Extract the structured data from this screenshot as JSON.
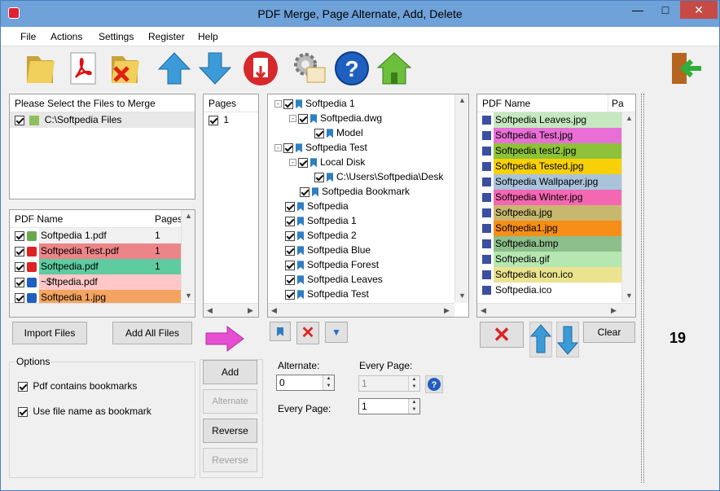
{
  "window": {
    "title": "PDF Merge, Page Alternate, Add, Delete",
    "minimize": "—",
    "maximize": "□",
    "close": "✕"
  },
  "menu": [
    "File",
    "Actions",
    "Settings",
    "Register",
    "Help"
  ],
  "files_panel": {
    "header": "Please Select the Files to Merge",
    "items": [
      {
        "label": "C:\\Softpedia Files"
      }
    ]
  },
  "pdf_list": {
    "col_name": "PDF Name",
    "col_pages": "Pages",
    "rows": [
      {
        "name": "Softpedia 1.pdf",
        "pages": "1",
        "color": "#f0f0f0"
      },
      {
        "name": "Softpedia Test.pdf",
        "pages": "1",
        "color": "#ec8587"
      },
      {
        "name": "Softpedia.pdf",
        "pages": "1",
        "color": "#5ecba1"
      },
      {
        "name": "~$ftpedia.pdf",
        "pages": "",
        "color": "#ffc7c7"
      },
      {
        "name": "Softpedia 1.jpg",
        "pages": "",
        "color": "#f4a460"
      }
    ]
  },
  "pages_panel": {
    "header": "Pages",
    "items": [
      "1"
    ]
  },
  "tree": {
    "rows": [
      {
        "label": "Softpedia 1",
        "indent": 0,
        "exp": "-"
      },
      {
        "label": "Softpedia.dwg",
        "indent": 1,
        "exp": "-"
      },
      {
        "label": "Model",
        "indent": 2,
        "exp": ""
      },
      {
        "label": "Softpedia Test",
        "indent": 0,
        "exp": "-"
      },
      {
        "label": "Local Disk",
        "indent": 1,
        "exp": "-"
      },
      {
        "label": "C:\\Users\\Softpedia\\Desk",
        "indent": 2,
        "exp": ""
      },
      {
        "label": "Softpedia Bookmark",
        "indent": 1,
        "exp": ""
      },
      {
        "label": "Softpedia",
        "indent": 0,
        "exp": ""
      },
      {
        "label": "Softpedia 1",
        "indent": 0,
        "exp": ""
      },
      {
        "label": "Softpedia 2",
        "indent": 0,
        "exp": ""
      },
      {
        "label": "Softpedia Blue",
        "indent": 0,
        "exp": ""
      },
      {
        "label": "Softpedia Forest",
        "indent": 0,
        "exp": ""
      },
      {
        "label": "Softpedia Leaves",
        "indent": 0,
        "exp": ""
      },
      {
        "label": "Softpedia Test",
        "indent": 0,
        "exp": ""
      }
    ]
  },
  "right_list": {
    "col_name": "PDF Name",
    "col_pages": "Pa",
    "rows": [
      {
        "name": "Softpedia Leaves.jpg",
        "color": "#c5e8c0"
      },
      {
        "name": "Softpedia Test.jpg",
        "color": "#e86fd6"
      },
      {
        "name": "Softpedia test2.jpg",
        "color": "#8ec23a"
      },
      {
        "name": "Softpedia Tested.jpg",
        "color": "#f8d008"
      },
      {
        "name": "Softpedia Wallpaper.jpg",
        "color": "#a9c3db"
      },
      {
        "name": "Softpedia Winter.jpg",
        "color": "#f467b3"
      },
      {
        "name": "Softpedia.jpg",
        "color": "#c8b86f"
      },
      {
        "name": "Softpedia1.jpg",
        "color": "#f68e17"
      },
      {
        "name": "Softpedia.bmp",
        "color": "#8dbf8a"
      },
      {
        "name": "Softpedia.gif",
        "color": "#b6e7b1"
      },
      {
        "name": "Softpedia Icon.ico",
        "color": "#ebe38e"
      },
      {
        "name": "Softpedia.ico",
        "color": "#ffffff"
      }
    ]
  },
  "buttons": {
    "import": "Import Files",
    "add_all": "Add All Files",
    "add": "Add",
    "alternate": "Alternate",
    "reverse1": "Reverse",
    "reverse2": "Reverse",
    "clear": "Clear"
  },
  "options": {
    "title": "Options",
    "opt1": "Pdf contains bookmarks",
    "opt2": "Use file name as bookmark"
  },
  "alternate": {
    "label": "Alternate:",
    "value": "0",
    "every_label": "Every Page:",
    "every_value": "1",
    "every2_label": "Every Page:",
    "every2_value": "1"
  },
  "count": "19"
}
